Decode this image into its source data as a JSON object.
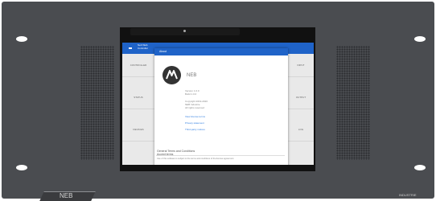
{
  "device": {
    "nameplate": "NEB",
    "maker_mark": "INDUSTRIE"
  },
  "app": {
    "title_line1": "Neb Web",
    "title_line2": "Controller",
    "tiles_left": [
      "CONTROLLER",
      "STATUS",
      "DEVICES"
    ],
    "tiles_right": [
      "INPUT",
      "OUTPUT",
      "LOG"
    ]
  },
  "about_dialog": {
    "header": "About",
    "brand": "NEB",
    "version_lines": [
      "Version 1.0.0",
      "Build 1.0.0"
    ],
    "copyright_lines": [
      "Copyright 2019-2020",
      "NEB Industrie",
      "All rights reserved"
    ],
    "links": [
      "View license terms",
      "Privacy statement",
      "Third-party notices"
    ],
    "footer_title": "General Terms and Conditions",
    "footer_sub": "Accept terms",
    "footer_note": "Use of this software is subject to the terms and conditions of the license agreement."
  },
  "colors": {
    "accent": "#1f63c8",
    "chassis": "#4a4c50",
    "link": "#2f7de0"
  },
  "icons": [
    "hamburger-icon",
    "neb-logo-icon"
  ]
}
